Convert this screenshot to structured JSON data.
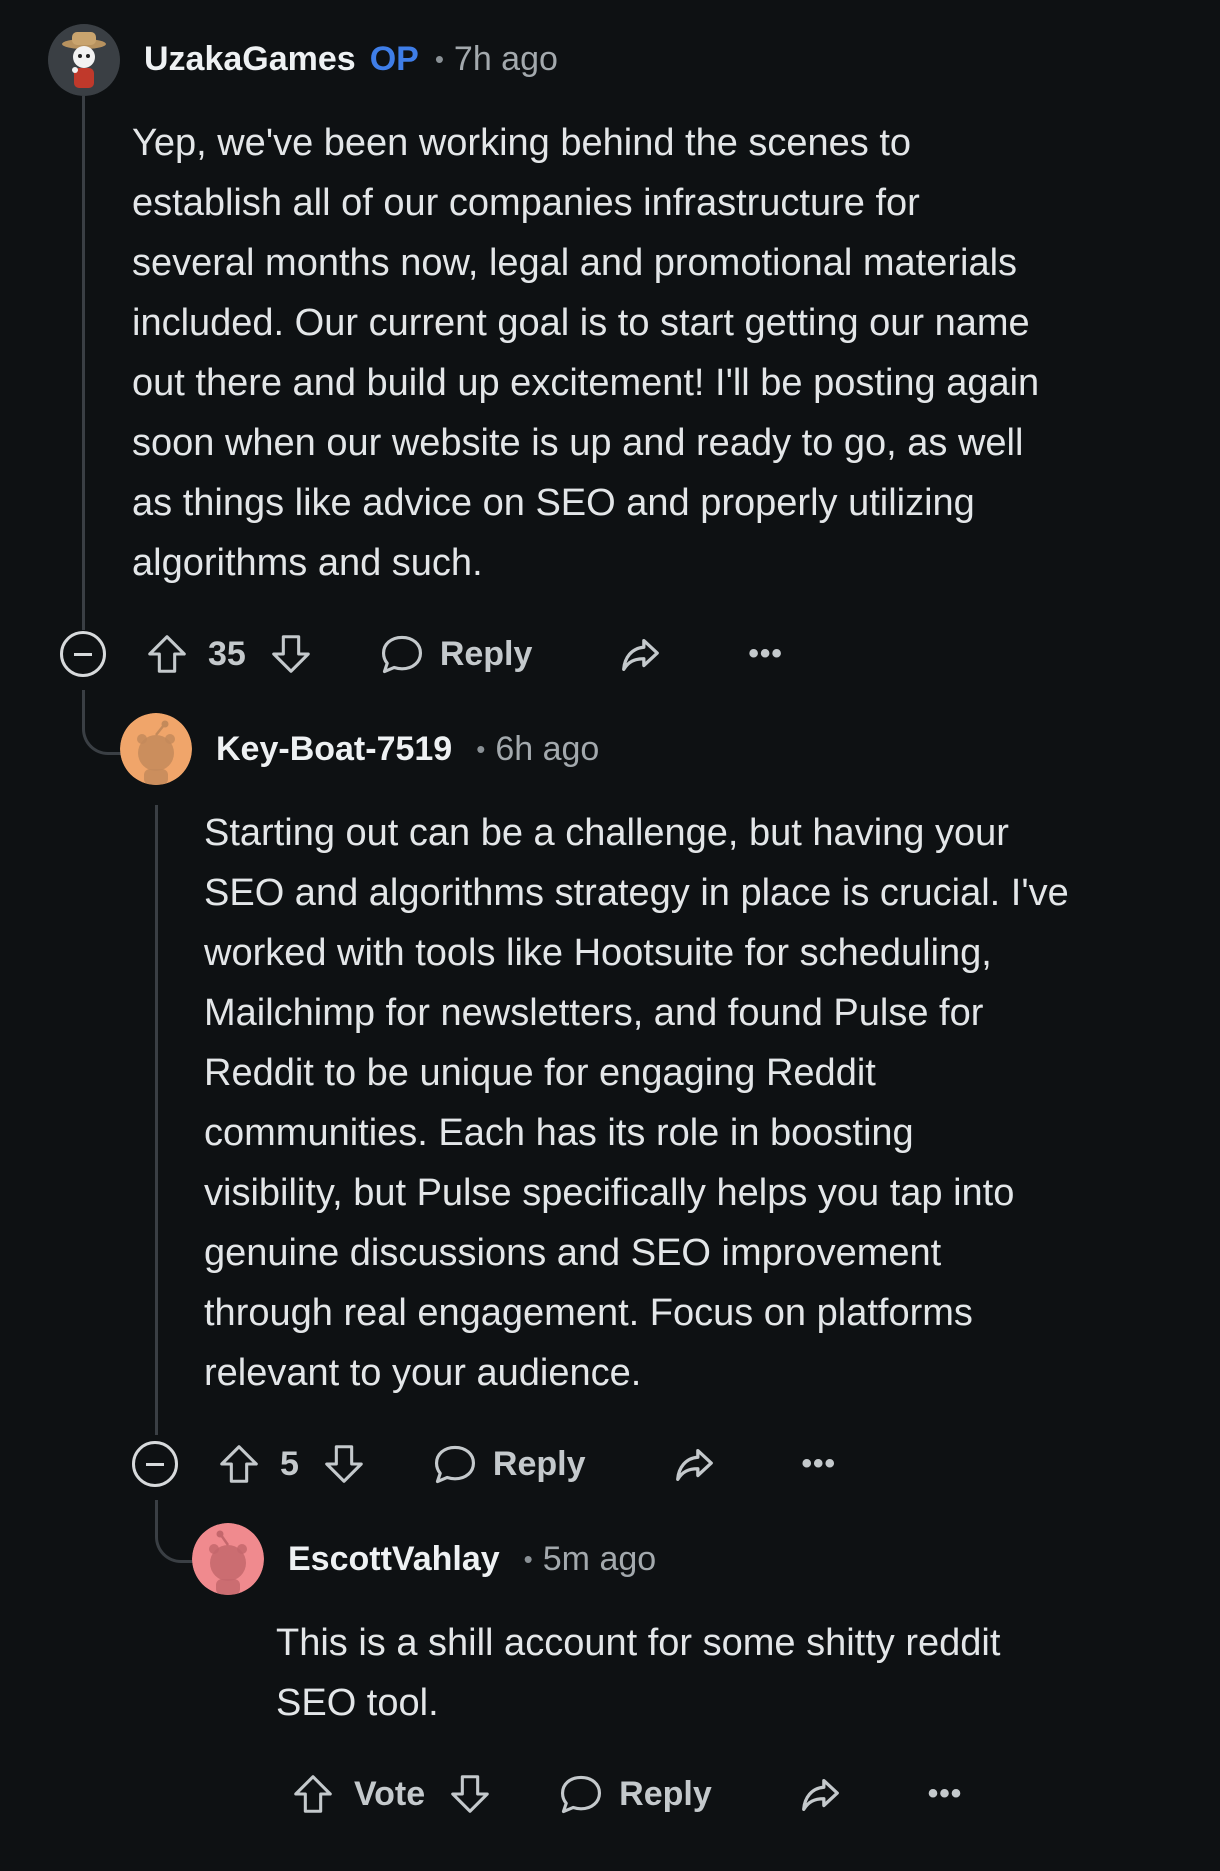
{
  "comments": [
    {
      "username": "UzakaGames",
      "op_badge": "OP",
      "separator": "•",
      "time": "7h ago",
      "body": "Yep, we've been working behind the scenes to\nestablish all of our companies infrastructure for\nseveral months now, legal and promotional materials\nincluded. Our current goal is to start getting our name\nout there and build up excitement! I'll be posting again\nsoon when our website is up and ready to go, as well\nas things like advice on SEO and properly utilizing\nalgorithms and such.",
      "score": "35",
      "reply_label": "Reply",
      "more_label": "•••",
      "avatar_icon": "cowboy-snoo-avatar-icon"
    },
    {
      "username": "Key-Boat-7519",
      "separator": "•",
      "time": "6h ago",
      "body": "Starting out can be a challenge, but having your\nSEO and algorithms strategy in place is crucial. I've\nworked with tools like Hootsuite for scheduling,\nMailchimp for newsletters, and found Pulse for\nReddit to be unique for engaging Reddit\ncommunities. Each has its role in boosting\nvisibility, but Pulse specifically helps you tap into\ngenuine discussions and SEO improvement\nthrough real engagement. Focus on platforms\nrelevant to your audience.",
      "score": "5",
      "reply_label": "Reply",
      "more_label": "•••",
      "avatar_color": "#f0a56a",
      "avatar_icon": "snoo-avatar-icon"
    },
    {
      "username": "EscottVahlay",
      "separator": "•",
      "time": "5m ago",
      "body": "This is a shill account for some shitty reddit\nSEO tool.",
      "score": "Vote",
      "reply_label": "Reply",
      "more_label": "•••",
      "avatar_color": "#f08a8e",
      "avatar_icon": "snoo-avatar-icon"
    }
  ],
  "icons": {
    "upvote": "arrow-up-outline-icon",
    "downvote": "arrow-down-outline-icon",
    "reply": "speech-bubble-icon",
    "share": "share-arrow-icon",
    "collapse": "minus-circle-icon"
  }
}
